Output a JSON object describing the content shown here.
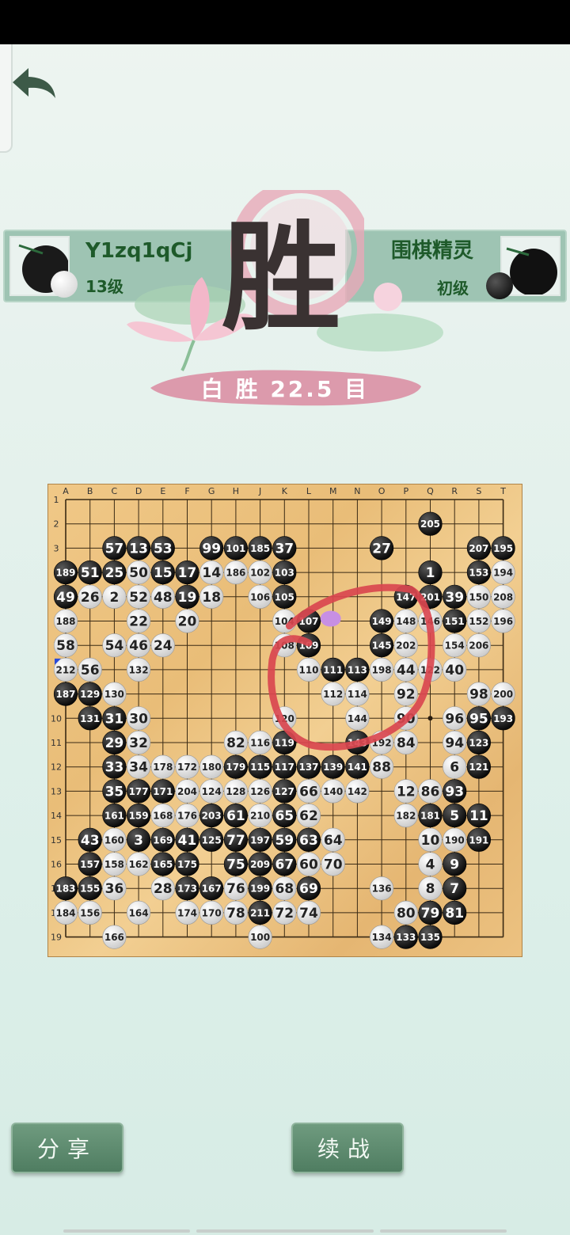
{
  "header": {
    "back_icon": "back-arrow-icon"
  },
  "players": {
    "left": {
      "name": "Y1zq1qCj",
      "rank": "13级",
      "stone": "white"
    },
    "right": {
      "name": "围棋精灵",
      "rank": "初级",
      "stone": "black"
    }
  },
  "victory_glyph": "胜",
  "result": "白 胜  22.5 目",
  "board": {
    "size": 19,
    "columns": [
      "A",
      "B",
      "C",
      "D",
      "E",
      "F",
      "G",
      "H",
      "J",
      "K",
      "L",
      "M",
      "N",
      "O",
      "P",
      "Q",
      "R",
      "S",
      "T"
    ],
    "rows": [
      "1",
      "2",
      "3",
      "4",
      "5",
      "6",
      "7",
      "8",
      "9",
      "10",
      "11",
      "12",
      "13",
      "14",
      "15",
      "16",
      "17",
      "18",
      "19"
    ],
    "stones": [
      {
        "c": 15,
        "r": 1,
        "color": "b",
        "n": "205"
      },
      {
        "c": 2,
        "r": 2,
        "color": "b",
        "n": "57"
      },
      {
        "c": 3,
        "r": 2,
        "color": "b",
        "n": "13"
      },
      {
        "c": 4,
        "r": 2,
        "color": "b",
        "n": "53"
      },
      {
        "c": 6,
        "r": 2,
        "color": "b",
        "n": "99"
      },
      {
        "c": 7,
        "r": 2,
        "color": "b",
        "n": "101"
      },
      {
        "c": 8,
        "r": 2,
        "color": "b",
        "n": "185"
      },
      {
        "c": 9,
        "r": 2,
        "color": "b",
        "n": "37"
      },
      {
        "c": 13,
        "r": 2,
        "color": "b",
        "n": "27"
      },
      {
        "c": 17,
        "r": 2,
        "color": "b",
        "n": "207"
      },
      {
        "c": 18,
        "r": 2,
        "color": "b",
        "n": "195"
      },
      {
        "c": 0,
        "r": 3,
        "color": "b",
        "n": "189"
      },
      {
        "c": 1,
        "r": 3,
        "color": "b",
        "n": "51"
      },
      {
        "c": 2,
        "r": 3,
        "color": "b",
        "n": "25"
      },
      {
        "c": 3,
        "r": 3,
        "color": "w",
        "n": "50"
      },
      {
        "c": 4,
        "r": 3,
        "color": "b",
        "n": "15"
      },
      {
        "c": 5,
        "r": 3,
        "color": "b",
        "n": "17"
      },
      {
        "c": 6,
        "r": 3,
        "color": "w",
        "n": "14"
      },
      {
        "c": 7,
        "r": 3,
        "color": "w",
        "n": "186"
      },
      {
        "c": 8,
        "r": 3,
        "color": "w",
        "n": "102"
      },
      {
        "c": 9,
        "r": 3,
        "color": "b",
        "n": "103"
      },
      {
        "c": 15,
        "r": 3,
        "color": "b",
        "n": "1"
      },
      {
        "c": 17,
        "r": 3,
        "color": "b",
        "n": "153"
      },
      {
        "c": 18,
        "r": 3,
        "color": "w",
        "n": "194"
      },
      {
        "c": 0,
        "r": 4,
        "color": "b",
        "n": "49"
      },
      {
        "c": 1,
        "r": 4,
        "color": "w",
        "n": "26"
      },
      {
        "c": 2,
        "r": 4,
        "color": "w",
        "n": "2"
      },
      {
        "c": 3,
        "r": 4,
        "color": "w",
        "n": "52"
      },
      {
        "c": 4,
        "r": 4,
        "color": "w",
        "n": "48"
      },
      {
        "c": 5,
        "r": 4,
        "color": "b",
        "n": "19"
      },
      {
        "c": 6,
        "r": 4,
        "color": "w",
        "n": "18"
      },
      {
        "c": 8,
        "r": 4,
        "color": "w",
        "n": "106"
      },
      {
        "c": 9,
        "r": 4,
        "color": "b",
        "n": "105"
      },
      {
        "c": 14,
        "r": 4,
        "color": "b",
        "n": "147"
      },
      {
        "c": 15,
        "r": 4,
        "color": "b",
        "n": "201"
      },
      {
        "c": 16,
        "r": 4,
        "color": "b",
        "n": "39"
      },
      {
        "c": 17,
        "r": 4,
        "color": "w",
        "n": "150"
      },
      {
        "c": 18,
        "r": 4,
        "color": "w",
        "n": "208"
      },
      {
        "c": 0,
        "r": 5,
        "color": "w",
        "n": "188"
      },
      {
        "c": 3,
        "r": 5,
        "color": "w",
        "n": "22"
      },
      {
        "c": 5,
        "r": 5,
        "color": "w",
        "n": "20"
      },
      {
        "c": 9,
        "r": 5,
        "color": "w",
        "n": "104"
      },
      {
        "c": 10,
        "r": 5,
        "color": "b",
        "n": "107"
      },
      {
        "c": 13,
        "r": 5,
        "color": "b",
        "n": "149"
      },
      {
        "c": 14,
        "r": 5,
        "color": "w",
        "n": "148"
      },
      {
        "c": 15,
        "r": 5,
        "color": "w",
        "n": "146"
      },
      {
        "c": 16,
        "r": 5,
        "color": "b",
        "n": "151"
      },
      {
        "c": 17,
        "r": 5,
        "color": "w",
        "n": "152"
      },
      {
        "c": 18,
        "r": 5,
        "color": "w",
        "n": "196"
      },
      {
        "c": 0,
        "r": 6,
        "color": "w",
        "n": "58"
      },
      {
        "c": 2,
        "r": 6,
        "color": "w",
        "n": "54"
      },
      {
        "c": 3,
        "r": 6,
        "color": "w",
        "n": "46"
      },
      {
        "c": 4,
        "r": 6,
        "color": "w",
        "n": "24"
      },
      {
        "c": 9,
        "r": 6,
        "color": "w",
        "n": "108"
      },
      {
        "c": 10,
        "r": 6,
        "color": "b",
        "n": "109"
      },
      {
        "c": 13,
        "r": 6,
        "color": "b",
        "n": "145"
      },
      {
        "c": 14,
        "r": 6,
        "color": "w",
        "n": "202"
      },
      {
        "c": 16,
        "r": 6,
        "color": "w",
        "n": "154"
      },
      {
        "c": 17,
        "r": 6,
        "color": "w",
        "n": "206"
      },
      {
        "c": 0,
        "r": 7,
        "color": "w",
        "n": "212"
      },
      {
        "c": 1,
        "r": 7,
        "color": "w",
        "n": "56"
      },
      {
        "c": 3,
        "r": 7,
        "color": "w",
        "n": "132"
      },
      {
        "c": 10,
        "r": 7,
        "color": "w",
        "n": "110"
      },
      {
        "c": 11,
        "r": 7,
        "color": "b",
        "n": "111"
      },
      {
        "c": 12,
        "r": 7,
        "color": "b",
        "n": "113"
      },
      {
        "c": 13,
        "r": 7,
        "color": "w",
        "n": "198"
      },
      {
        "c": 14,
        "r": 7,
        "color": "w",
        "n": "44"
      },
      {
        "c": 15,
        "r": 7,
        "color": "w",
        "n": "122"
      },
      {
        "c": 16,
        "r": 7,
        "color": "w",
        "n": "40"
      },
      {
        "c": 0,
        "r": 8,
        "color": "b",
        "n": "187"
      },
      {
        "c": 1,
        "r": 8,
        "color": "b",
        "n": "129"
      },
      {
        "c": 2,
        "r": 8,
        "color": "w",
        "n": "130"
      },
      {
        "c": 11,
        "r": 8,
        "color": "w",
        "n": "112"
      },
      {
        "c": 12,
        "r": 8,
        "color": "w",
        "n": "114"
      },
      {
        "c": 14,
        "r": 8,
        "color": "w",
        "n": "92"
      },
      {
        "c": 17,
        "r": 8,
        "color": "w",
        "n": "98"
      },
      {
        "c": 18,
        "r": 8,
        "color": "w",
        "n": "200"
      },
      {
        "c": 1,
        "r": 9,
        "color": "b",
        "n": "131"
      },
      {
        "c": 2,
        "r": 9,
        "color": "b",
        "n": "31"
      },
      {
        "c": 3,
        "r": 9,
        "color": "w",
        "n": "30"
      },
      {
        "c": 9,
        "r": 9,
        "color": "w",
        "n": "120"
      },
      {
        "c": 12,
        "r": 9,
        "color": "w",
        "n": "144"
      },
      {
        "c": 14,
        "r": 9,
        "color": "w",
        "n": "90"
      },
      {
        "c": 16,
        "r": 9,
        "color": "w",
        "n": "96"
      },
      {
        "c": 17,
        "r": 9,
        "color": "b",
        "n": "95"
      },
      {
        "c": 18,
        "r": 9,
        "color": "b",
        "n": "193"
      },
      {
        "c": 2,
        "r": 10,
        "color": "b",
        "n": "29"
      },
      {
        "c": 3,
        "r": 10,
        "color": "w",
        "n": "32"
      },
      {
        "c": 7,
        "r": 10,
        "color": "w",
        "n": "82"
      },
      {
        "c": 8,
        "r": 10,
        "color": "w",
        "n": "116"
      },
      {
        "c": 9,
        "r": 10,
        "color": "b",
        "n": "119"
      },
      {
        "c": 12,
        "r": 10,
        "color": "b",
        "n": "143"
      },
      {
        "c": 13,
        "r": 10,
        "color": "w",
        "n": "192"
      },
      {
        "c": 14,
        "r": 10,
        "color": "w",
        "n": "84"
      },
      {
        "c": 16,
        "r": 10,
        "color": "w",
        "n": "94"
      },
      {
        "c": 17,
        "r": 10,
        "color": "b",
        "n": "123"
      },
      {
        "c": 2,
        "r": 11,
        "color": "b",
        "n": "33"
      },
      {
        "c": 3,
        "r": 11,
        "color": "w",
        "n": "34"
      },
      {
        "c": 4,
        "r": 11,
        "color": "w",
        "n": "178"
      },
      {
        "c": 5,
        "r": 11,
        "color": "w",
        "n": "172"
      },
      {
        "c": 6,
        "r": 11,
        "color": "w",
        "n": "180"
      },
      {
        "c": 7,
        "r": 11,
        "color": "b",
        "n": "179"
      },
      {
        "c": 8,
        "r": 11,
        "color": "b",
        "n": "115"
      },
      {
        "c": 9,
        "r": 11,
        "color": "b",
        "n": "117"
      },
      {
        "c": 10,
        "r": 11,
        "color": "b",
        "n": "137"
      },
      {
        "c": 11,
        "r": 11,
        "color": "b",
        "n": "139"
      },
      {
        "c": 12,
        "r": 11,
        "color": "b",
        "n": "141"
      },
      {
        "c": 13,
        "r": 11,
        "color": "w",
        "n": "88"
      },
      {
        "c": 16,
        "r": 11,
        "color": "w",
        "n": "6"
      },
      {
        "c": 17,
        "r": 11,
        "color": "b",
        "n": "121"
      },
      {
        "c": 2,
        "r": 12,
        "color": "b",
        "n": "35"
      },
      {
        "c": 3,
        "r": 12,
        "color": "b",
        "n": "177"
      },
      {
        "c": 4,
        "r": 12,
        "color": "b",
        "n": "171"
      },
      {
        "c": 5,
        "r": 12,
        "color": "w",
        "n": "204"
      },
      {
        "c": 6,
        "r": 12,
        "color": "w",
        "n": "124"
      },
      {
        "c": 7,
        "r": 12,
        "color": "w",
        "n": "128"
      },
      {
        "c": 8,
        "r": 12,
        "color": "w",
        "n": "126"
      },
      {
        "c": 9,
        "r": 12,
        "color": "b",
        "n": "127"
      },
      {
        "c": 10,
        "r": 12,
        "color": "w",
        "n": "66"
      },
      {
        "c": 11,
        "r": 12,
        "color": "w",
        "n": "140"
      },
      {
        "c": 12,
        "r": 12,
        "color": "w",
        "n": "142"
      },
      {
        "c": 14,
        "r": 12,
        "color": "w",
        "n": "12"
      },
      {
        "c": 15,
        "r": 12,
        "color": "w",
        "n": "86"
      },
      {
        "c": 16,
        "r": 12,
        "color": "b",
        "n": "93"
      },
      {
        "c": 2,
        "r": 13,
        "color": "b",
        "n": "161"
      },
      {
        "c": 3,
        "r": 13,
        "color": "b",
        "n": "159"
      },
      {
        "c": 4,
        "r": 13,
        "color": "w",
        "n": "168"
      },
      {
        "c": 5,
        "r": 13,
        "color": "w",
        "n": "176"
      },
      {
        "c": 6,
        "r": 13,
        "color": "b",
        "n": "203"
      },
      {
        "c": 7,
        "r": 13,
        "color": "b",
        "n": "61"
      },
      {
        "c": 8,
        "r": 13,
        "color": "w",
        "n": "210"
      },
      {
        "c": 9,
        "r": 13,
        "color": "b",
        "n": "65"
      },
      {
        "c": 10,
        "r": 13,
        "color": "w",
        "n": "62"
      },
      {
        "c": 14,
        "r": 13,
        "color": "w",
        "n": "182"
      },
      {
        "c": 15,
        "r": 13,
        "color": "b",
        "n": "181"
      },
      {
        "c": 16,
        "r": 13,
        "color": "b",
        "n": "5"
      },
      {
        "c": 17,
        "r": 13,
        "color": "b",
        "n": "11"
      },
      {
        "c": 1,
        "r": 14,
        "color": "b",
        "n": "43"
      },
      {
        "c": 2,
        "r": 14,
        "color": "w",
        "n": "160"
      },
      {
        "c": 3,
        "r": 14,
        "color": "b",
        "n": "3"
      },
      {
        "c": 4,
        "r": 14,
        "color": "b",
        "n": "169"
      },
      {
        "c": 5,
        "r": 14,
        "color": "b",
        "n": "41"
      },
      {
        "c": 6,
        "r": 14,
        "color": "b",
        "n": "125"
      },
      {
        "c": 7,
        "r": 14,
        "color": "b",
        "n": "77"
      },
      {
        "c": 8,
        "r": 14,
        "color": "b",
        "n": "197"
      },
      {
        "c": 9,
        "r": 14,
        "color": "b",
        "n": "59"
      },
      {
        "c": 10,
        "r": 14,
        "color": "b",
        "n": "63"
      },
      {
        "c": 11,
        "r": 14,
        "color": "w",
        "n": "64"
      },
      {
        "c": 15,
        "r": 14,
        "color": "w",
        "n": "10"
      },
      {
        "c": 16,
        "r": 14,
        "color": "w",
        "n": "190"
      },
      {
        "c": 17,
        "r": 14,
        "color": "b",
        "n": "191"
      },
      {
        "c": 1,
        "r": 15,
        "color": "b",
        "n": "157"
      },
      {
        "c": 2,
        "r": 15,
        "color": "w",
        "n": "158"
      },
      {
        "c": 3,
        "r": 15,
        "color": "w",
        "n": "162"
      },
      {
        "c": 4,
        "r": 15,
        "color": "b",
        "n": "165"
      },
      {
        "c": 5,
        "r": 15,
        "color": "b",
        "n": "175"
      },
      {
        "c": 7,
        "r": 15,
        "color": "b",
        "n": "75"
      },
      {
        "c": 8,
        "r": 15,
        "color": "b",
        "n": "209"
      },
      {
        "c": 9,
        "r": 15,
        "color": "b",
        "n": "67"
      },
      {
        "c": 10,
        "r": 15,
        "color": "w",
        "n": "60"
      },
      {
        "c": 11,
        "r": 15,
        "color": "w",
        "n": "70"
      },
      {
        "c": 15,
        "r": 15,
        "color": "w",
        "n": "4"
      },
      {
        "c": 16,
        "r": 15,
        "color": "b",
        "n": "9"
      },
      {
        "c": 0,
        "r": 16,
        "color": "b",
        "n": "183"
      },
      {
        "c": 1,
        "r": 16,
        "color": "b",
        "n": "155"
      },
      {
        "c": 2,
        "r": 16,
        "color": "w",
        "n": "36"
      },
      {
        "c": 4,
        "r": 16,
        "color": "w",
        "n": "28"
      },
      {
        "c": 5,
        "r": 16,
        "color": "b",
        "n": "173"
      },
      {
        "c": 6,
        "r": 16,
        "color": "b",
        "n": "167"
      },
      {
        "c": 7,
        "r": 16,
        "color": "w",
        "n": "76"
      },
      {
        "c": 8,
        "r": 16,
        "color": "b",
        "n": "199"
      },
      {
        "c": 9,
        "r": 16,
        "color": "w",
        "n": "68"
      },
      {
        "c": 10,
        "r": 16,
        "color": "b",
        "n": "69"
      },
      {
        "c": 13,
        "r": 16,
        "color": "w",
        "n": "136"
      },
      {
        "c": 15,
        "r": 16,
        "color": "w",
        "n": "8"
      },
      {
        "c": 16,
        "r": 16,
        "color": "b",
        "n": "7"
      },
      {
        "c": 0,
        "r": 17,
        "color": "w",
        "n": "184"
      },
      {
        "c": 1,
        "r": 17,
        "color": "w",
        "n": "156"
      },
      {
        "c": 3,
        "r": 17,
        "color": "w",
        "n": "164"
      },
      {
        "c": 5,
        "r": 17,
        "color": "w",
        "n": "174"
      },
      {
        "c": 6,
        "r": 17,
        "color": "w",
        "n": "170"
      },
      {
        "c": 7,
        "r": 17,
        "color": "w",
        "n": "78"
      },
      {
        "c": 8,
        "r": 17,
        "color": "b",
        "n": "211"
      },
      {
        "c": 9,
        "r": 17,
        "color": "w",
        "n": "72"
      },
      {
        "c": 10,
        "r": 17,
        "color": "w",
        "n": "74"
      },
      {
        "c": 14,
        "r": 17,
        "color": "w",
        "n": "80"
      },
      {
        "c": 15,
        "r": 17,
        "color": "b",
        "n": "79"
      },
      {
        "c": 16,
        "r": 17,
        "color": "b",
        "n": "81"
      },
      {
        "c": 2,
        "r": 18,
        "color": "w",
        "n": "166"
      },
      {
        "c": 8,
        "r": 18,
        "color": "w",
        "n": "100"
      },
      {
        "c": 13,
        "r": 18,
        "color": "w",
        "n": "134"
      },
      {
        "c": 14,
        "r": 18,
        "color": "b",
        "n": "133"
      },
      {
        "c": 15,
        "r": 18,
        "color": "b",
        "n": "135"
      }
    ],
    "annotation_color": "#d9474f",
    "marker_color": "#c78fe3"
  },
  "buttons": {
    "share": "分享",
    "continue": "续战"
  },
  "colors": {
    "accent": "#1e5a2a",
    "button": "#5f8c70"
  }
}
